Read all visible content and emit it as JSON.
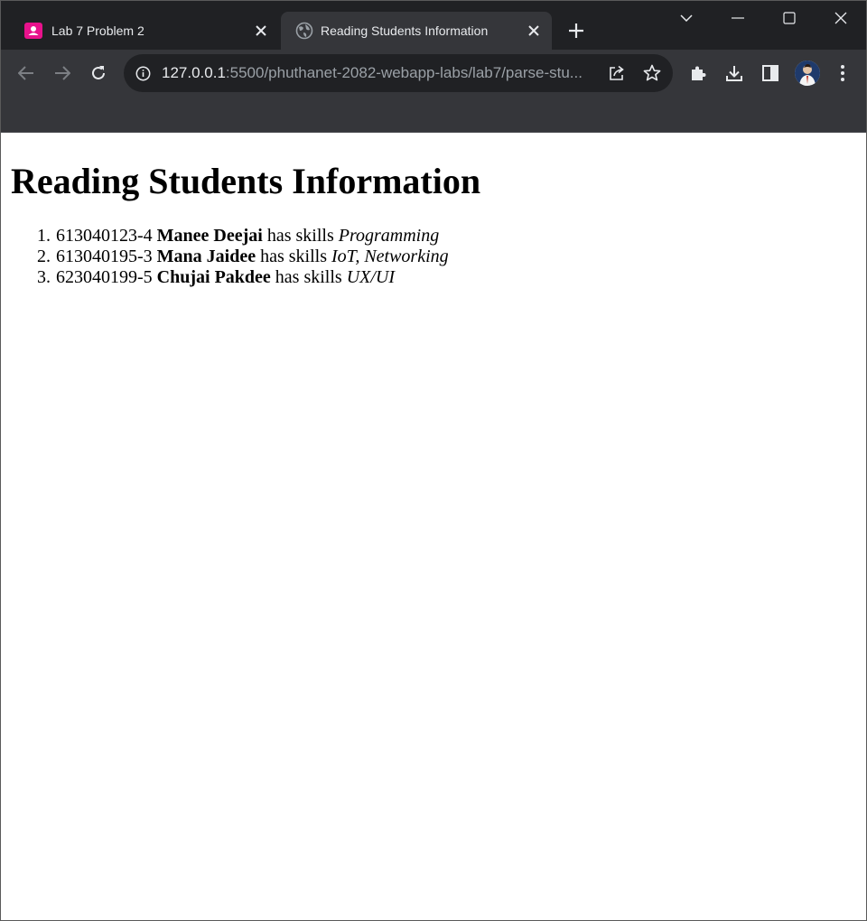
{
  "browser": {
    "tabs": [
      {
        "title": "Lab 7 Problem 2",
        "active": false
      },
      {
        "title": "Reading Students Information",
        "active": true
      }
    ],
    "url": {
      "host": "127.0.0.1",
      "rest": ":5500/phuthanet-2082-webapp-labs/lab7/parse-stu..."
    },
    "colors": {
      "tabstrip": "#202124",
      "toolbar": "#35363a",
      "favicon_accent": "#e8128c"
    },
    "icons": {
      "back": "arrow-left-icon",
      "forward": "arrow-right-icon",
      "reload": "reload-icon",
      "info": "info-icon",
      "share": "share-icon",
      "bookmark": "star-icon",
      "extensions": "puzzle-icon",
      "downloads": "download-icon",
      "sidepanel": "side-panel-icon",
      "menu": "kebab-menu-icon"
    }
  },
  "page": {
    "heading": "Reading Students Information",
    "students": [
      {
        "num": "1.",
        "id": "613040123-4",
        "name": "Manee Deejai",
        "has_skills": "has skills",
        "skills": "Programming"
      },
      {
        "num": "2.",
        "id": "613040195-3",
        "name": "Mana Jaidee",
        "has_skills": "has skills",
        "skills": "IoT, Networking"
      },
      {
        "num": "3.",
        "id": "623040199-5",
        "name": "Chujai Pakdee",
        "has_skills": "has skills",
        "skills": "UX/UI"
      }
    ]
  }
}
